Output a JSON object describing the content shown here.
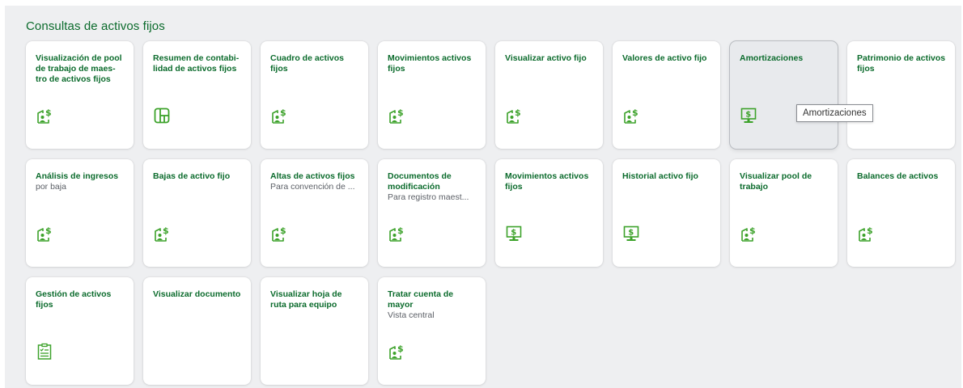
{
  "section": {
    "title": "Consultas de activos fijos"
  },
  "colors": {
    "accent": "#0b6b2c",
    "icon": "#3ca22a"
  },
  "tiles": [
    {
      "title": "Visualización de pool de trabajo de maes-tro de activos fijos",
      "subtitle": "",
      "icon": "asset-money-icon",
      "hovered": false
    },
    {
      "title": "Resumen de contabi-lidad de activos fijos",
      "subtitle": "",
      "icon": "dashboard-icon",
      "hovered": false
    },
    {
      "title": "Cuadro de activos fijos",
      "subtitle": "",
      "icon": "asset-money-icon",
      "hovered": false
    },
    {
      "title": "Movimientos activos fijos",
      "subtitle": "",
      "icon": "asset-money-icon",
      "hovered": false
    },
    {
      "title": "Visualizar activo fijo",
      "subtitle": "",
      "icon": "asset-money-icon",
      "hovered": false
    },
    {
      "title": "Valores de activo fijo",
      "subtitle": "",
      "icon": "asset-money-icon",
      "hovered": false
    },
    {
      "title": "Amortizaciones",
      "subtitle": "",
      "icon": "monitor-money-icon",
      "hovered": true
    },
    {
      "title": "Patrimonio de activos fijos",
      "subtitle": "",
      "icon": "none",
      "hovered": false
    },
    {
      "title": "Análisis de ingresos",
      "subtitle": "por baja",
      "icon": "asset-money-icon",
      "hovered": false
    },
    {
      "title": "Bajas de activo fijo",
      "subtitle": "",
      "icon": "asset-money-icon",
      "hovered": false
    },
    {
      "title": "Altas de activos fijos",
      "subtitle": "Para convención de ...",
      "icon": "asset-money-icon",
      "hovered": false
    },
    {
      "title": "Documentos de modificación",
      "subtitle": "Para registro maest...",
      "icon": "asset-money-icon",
      "hovered": false
    },
    {
      "title": "Movimientos activos fijos",
      "subtitle": "",
      "icon": "monitor-money-icon",
      "hovered": false
    },
    {
      "title": "Historial activo fijo",
      "subtitle": "",
      "icon": "monitor-money-icon",
      "hovered": false
    },
    {
      "title": "Visualizar pool de trabajo",
      "subtitle": "",
      "icon": "asset-money-icon",
      "hovered": false
    },
    {
      "title": "Balances de activos",
      "subtitle": "",
      "icon": "asset-money-icon",
      "hovered": false
    },
    {
      "title": "Gestión de activos fijos",
      "subtitle": "",
      "icon": "checklist-icon",
      "hovered": false
    },
    {
      "title": "Visualizar documento",
      "subtitle": "",
      "icon": "none",
      "hovered": false
    },
    {
      "title": "Visualizar hoja de ruta para equipo",
      "subtitle": "",
      "icon": "none",
      "hovered": false
    },
    {
      "title": "Tratar cuenta de mayor",
      "subtitle": "Vista central",
      "icon": "asset-money-icon",
      "hovered": false
    }
  ],
  "tooltip": {
    "text": "Amortizaciones"
  }
}
